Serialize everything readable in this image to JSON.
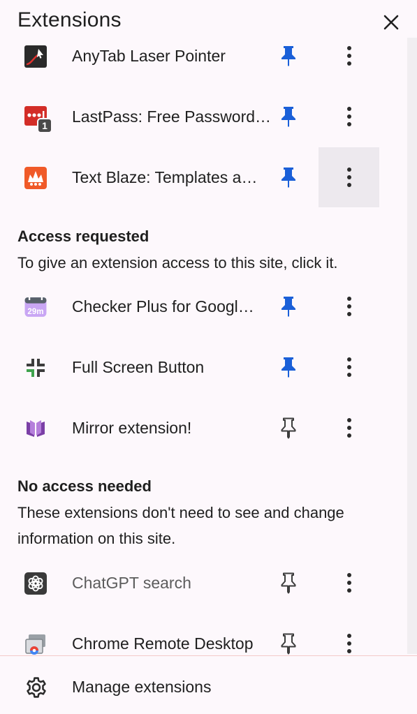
{
  "header": {
    "title": "Extensions"
  },
  "pinned": [
    {
      "name": "AnyTab Laser Pointer",
      "icon": "laser-pointer-icon",
      "pinned": true
    },
    {
      "name": "LastPass: Free Password…",
      "icon": "lastpass-icon",
      "badge": "1",
      "pinned": true
    },
    {
      "name": "Text Blaze: Templates a…",
      "icon": "text-blaze-icon",
      "pinned": true
    }
  ],
  "access_requested": {
    "title": "Access requested",
    "desc": "To give an extension access to this site, click it.",
    "items": [
      {
        "name": "Checker Plus for Googl…",
        "icon": "calendar-icon",
        "icon_text": "29m",
        "pinned": true
      },
      {
        "name": "Full Screen Button",
        "icon": "fullscreen-icon",
        "pinned": true
      },
      {
        "name": "Mirror extension!",
        "icon": "mirror-book-icon",
        "pinned": false
      }
    ]
  },
  "no_access": {
    "title": "No access needed",
    "desc": "These extensions don't need to see and change information on this site.",
    "items": [
      {
        "name": "ChatGPT search",
        "icon": "chatgpt-icon",
        "pinned": false
      },
      {
        "name": "Chrome Remote Desktop",
        "icon": "remote-desktop-icon",
        "pinned": false
      }
    ]
  },
  "footer": {
    "label": "Manage extensions",
    "icon": "gear-icon"
  },
  "colors": {
    "pin_active": "#1a5fd8",
    "pin_inactive": "#3c3c3c",
    "background": "#fdf8fc"
  }
}
